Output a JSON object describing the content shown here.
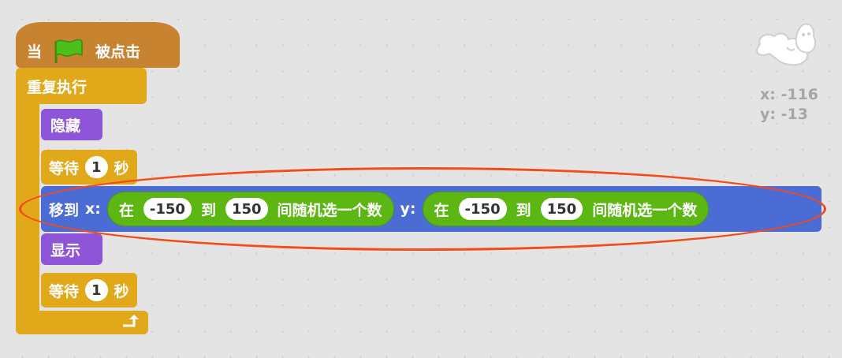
{
  "script": {
    "hat": {
      "prefix": "当",
      "icon": "green-flag-icon",
      "suffix": "被点击"
    },
    "loop": {
      "label": "重复执行",
      "end_icon": "loop-arrow-icon"
    },
    "hide": {
      "label": "隐藏"
    },
    "wait1": {
      "label": "等待",
      "value": "1",
      "unit": "秒"
    },
    "goto": {
      "label": "移到",
      "x_label": "x:",
      "y_label": "y:",
      "x_random": {
        "in": "在",
        "from": "-150",
        "to_label": "到",
        "to": "150",
        "suffix": "间随机选一个数"
      },
      "y_random": {
        "in": "在",
        "from": "-150",
        "to_label": "到",
        "to": "150",
        "suffix": "间随机选一个数"
      }
    },
    "show": {
      "label": "显示"
    },
    "wait2": {
      "label": "等待",
      "value": "1",
      "unit": "秒"
    }
  },
  "sprite_info": {
    "x": "x: -116",
    "y": "y: -13"
  },
  "colors": {
    "events": "#c88330",
    "control": "#e1a91a",
    "looks": "#8f55d8",
    "motion": "#4a6cd4",
    "operators": "#5cb712",
    "annotation": "#f44a1c"
  }
}
